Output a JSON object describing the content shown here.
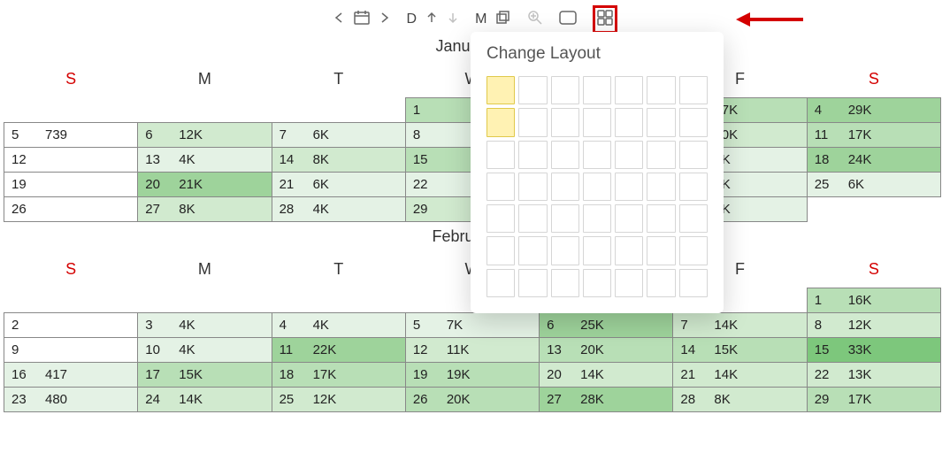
{
  "toolbar": {
    "d_label": "D",
    "m_label": "M"
  },
  "popover": {
    "title": "Change Layout",
    "rows": 7,
    "cols": 7,
    "selected": [
      [
        0,
        0
      ],
      [
        1,
        0
      ]
    ]
  },
  "day_headers": [
    "S",
    "M",
    "T",
    "W",
    "T",
    "F",
    "S"
  ],
  "months": [
    {
      "title": "January 20",
      "weeks": [
        [
          null,
          null,
          null,
          {
            "d": "1",
            "v": "",
            "s": 3
          },
          null,
          {
            "d": "",
            "v": "17K",
            "s": 3
          },
          {
            "d": "4",
            "v": "29K",
            "s": 4
          }
        ],
        [
          {
            "d": "5",
            "v": "739",
            "s": 0
          },
          {
            "d": "6",
            "v": "12K",
            "s": 2
          },
          {
            "d": "7",
            "v": "6K",
            "s": 1
          },
          {
            "d": "8",
            "v": "",
            "s": 1
          },
          null,
          {
            "d": "",
            "v": "10K",
            "s": 2
          },
          {
            "d": "11",
            "v": "17K",
            "s": 3
          }
        ],
        [
          {
            "d": "12",
            "v": "",
            "s": 0
          },
          {
            "d": "13",
            "v": "4K",
            "s": 1
          },
          {
            "d": "14",
            "v": "8K",
            "s": 2
          },
          {
            "d": "15",
            "v": "",
            "s": 3
          },
          null,
          {
            "d": "",
            "v": "1K",
            "s": 1
          },
          {
            "d": "18",
            "v": "24K",
            "s": 4
          }
        ],
        [
          {
            "d": "19",
            "v": "",
            "s": 0
          },
          {
            "d": "20",
            "v": "21K",
            "s": 4
          },
          {
            "d": "21",
            "v": "6K",
            "s": 1
          },
          {
            "d": "22",
            "v": "",
            "s": 1
          },
          null,
          {
            "d": "",
            "v": "6K",
            "s": 1
          },
          {
            "d": "25",
            "v": "6K",
            "s": 1
          }
        ],
        [
          {
            "d": "26",
            "v": "",
            "s": 0
          },
          {
            "d": "27",
            "v": "8K",
            "s": 2
          },
          {
            "d": "28",
            "v": "4K",
            "s": 1
          },
          {
            "d": "29",
            "v": "",
            "s": 2
          },
          null,
          {
            "d": "",
            "v": "4K",
            "s": 1
          },
          null
        ]
      ]
    },
    {
      "title": "February 20",
      "weeks": [
        [
          null,
          null,
          null,
          null,
          null,
          null,
          {
            "d": "1",
            "v": "16K",
            "s": 3
          }
        ],
        [
          {
            "d": "2",
            "v": "",
            "s": 0
          },
          {
            "d": "3",
            "v": "4K",
            "s": 1
          },
          {
            "d": "4",
            "v": "4K",
            "s": 1
          },
          {
            "d": "5",
            "v": "7K",
            "s": 1
          },
          {
            "d": "6",
            "v": "25K",
            "s": 4
          },
          {
            "d": "7",
            "v": "14K",
            "s": 2
          },
          {
            "d": "8",
            "v": "12K",
            "s": 2
          }
        ],
        [
          {
            "d": "9",
            "v": "",
            "s": 0
          },
          {
            "d": "10",
            "v": "4K",
            "s": 1
          },
          {
            "d": "11",
            "v": "22K",
            "s": 4
          },
          {
            "d": "12",
            "v": "11K",
            "s": 2
          },
          {
            "d": "13",
            "v": "20K",
            "s": 3
          },
          {
            "d": "14",
            "v": "15K",
            "s": 3
          },
          {
            "d": "15",
            "v": "33K",
            "s": 5
          }
        ],
        [
          {
            "d": "16",
            "v": "417",
            "s": 1
          },
          {
            "d": "17",
            "v": "15K",
            "s": 3
          },
          {
            "d": "18",
            "v": "17K",
            "s": 3
          },
          {
            "d": "19",
            "v": "19K",
            "s": 3
          },
          {
            "d": "20",
            "v": "14K",
            "s": 2
          },
          {
            "d": "21",
            "v": "14K",
            "s": 2
          },
          {
            "d": "22",
            "v": "13K",
            "s": 2
          }
        ],
        [
          {
            "d": "23",
            "v": "480",
            "s": 1
          },
          {
            "d": "24",
            "v": "14K",
            "s": 2
          },
          {
            "d": "25",
            "v": "12K",
            "s": 2
          },
          {
            "d": "26",
            "v": "20K",
            "s": 3
          },
          {
            "d": "27",
            "v": "28K",
            "s": 4
          },
          {
            "d": "28",
            "v": "8K",
            "s": 2
          },
          {
            "d": "29",
            "v": "17K",
            "s": 3
          }
        ]
      ]
    }
  ]
}
